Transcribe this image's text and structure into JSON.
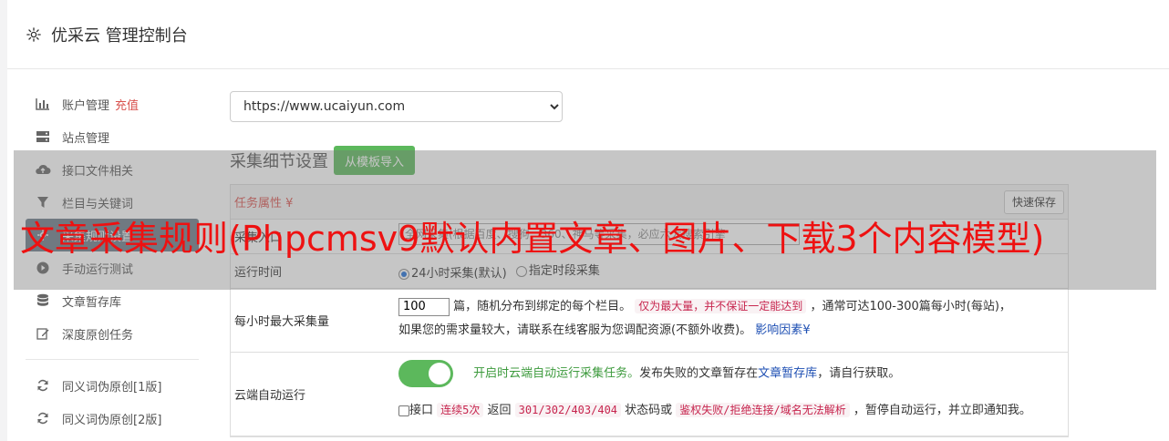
{
  "header": {
    "title": "优采云 管理控制台",
    "icon": "gear-icon"
  },
  "sidebar": {
    "items": [
      {
        "label": "账户管理",
        "badge": "充值",
        "icon": "bar-chart-icon"
      },
      {
        "label": "站点管理",
        "icon": "server-icon"
      },
      {
        "label": "接口文件相关",
        "icon": "cloud-upload-icon"
      },
      {
        "label": "栏目与关键词",
        "icon": "filter-icon"
      },
      {
        "label": "采集规则设置",
        "icon": "gear-icon"
      },
      {
        "label": "手动运行测试",
        "icon": "play-icon"
      },
      {
        "label": "文章暂存库",
        "icon": "database-icon"
      },
      {
        "label": "深度原创任务",
        "icon": "edit-icon"
      },
      {
        "label": "同义词伪原创[1版]",
        "icon": "refresh-icon"
      },
      {
        "label": "同义词伪原创[2版]",
        "icon": "refresh-icon"
      }
    ]
  },
  "main": {
    "site_select": {
      "value": "https://www.ucaiyun.com"
    },
    "section_title": "采集细节设置",
    "template_button": "从模板导入",
    "panel": {
      "attr_label": "任务属性 ¥",
      "save_button": "快速保存",
      "scope": {
        "label": "采集入口",
        "value": "全网采集(根据百度、搜狗、360、神马等采集，必应六大搜索引擎"
      },
      "run_time": {
        "label": "运行时间",
        "option1": "24小时采集(默认)",
        "option2": "指定时段采集"
      },
      "max_per_hour": {
        "label": "每小时最大采集量",
        "value": "100",
        "text1": "篇，随机分布到绑定的每个栏目。",
        "code1": "仅为最大量，并不保证一定能达到",
        "text2": "，通常可达100-300篇每小时(每站)，",
        "text3": "如果您的需求量较大，请联系在线客服为您调配资源(不额外收费)。",
        "link": "影响因素"
      },
      "cloud_auto": {
        "label": "云端自动运行",
        "green_text": "开启时云端自动运行采集任务。",
        "text1": "发布失败的文章暂存在",
        "link": "文章暂存库",
        "text2": "，请自行获取。",
        "chk_label": "接口",
        "code1": "连续5次",
        "text3": " 返回 ",
        "code2": "301/302/403/404",
        "text4": " 状态码或 ",
        "code3": "鉴权失败/拒绝连接/域名无法解析",
        "text5": " ，暂停自动运行，并立即通知我。"
      }
    }
  },
  "overlay": {
    "text": "文章采集规则(Phpcmsv9默认内置文章、图片、下载3个内容模型)"
  },
  "colors": {
    "accent_green": "#5cb85c",
    "overlay_red": "#ee1111",
    "code_red": "#c7254e"
  }
}
